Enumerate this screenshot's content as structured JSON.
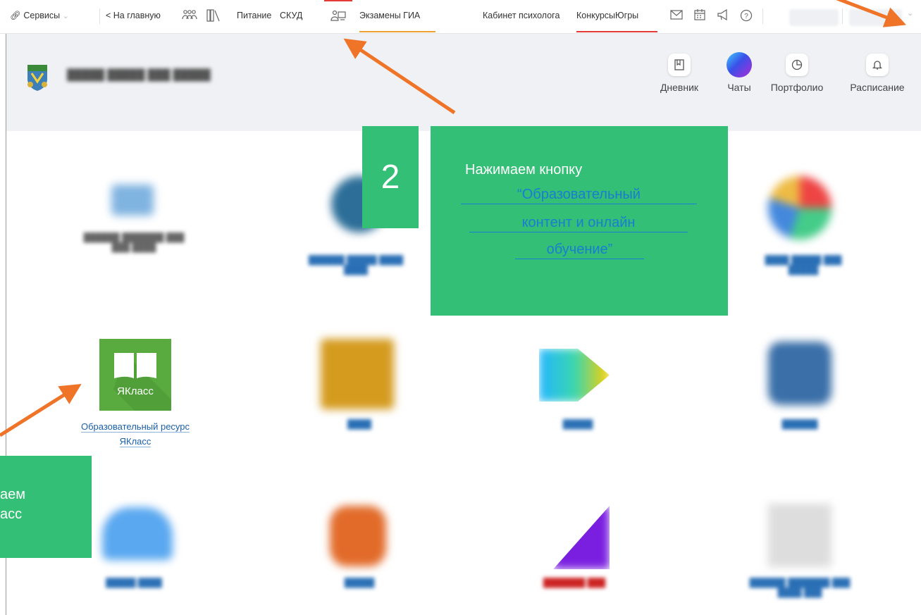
{
  "topbar": {
    "services": "Сервисы",
    "to_main": "< На главную",
    "nutrition": "Питание",
    "skud": "СКУД",
    "exams": "Экзамены ГИА",
    "psychologist": "Кабинет психолога",
    "contests": "КонкурсыЮгры"
  },
  "header": {
    "diary": "Дневник",
    "chats": "Чаты",
    "portfolio": "Портфолио",
    "schedule": "Расписание"
  },
  "content": {
    "yaklass_tile_text": "ЯКласс",
    "yaklass_label_line1": "Образовательный ресурс",
    "yaklass_label_line2": "ЯКласс"
  },
  "overlay": {
    "step_number": "2",
    "callout2_title": "Нажимаем кнопку",
    "callout2_link_line1": "“Образовательный",
    "callout2_link_line2": "контент и онлайн",
    "callout2_link_line3": "обучение”",
    "callout1_line1": "аем",
    "callout1_line2": "асс"
  },
  "colors": {
    "callout_green": "#33bf75",
    "arrow_orange": "#ef7428",
    "link_blue": "#1a7dd4",
    "yaklass_green": "#5aab3f"
  }
}
